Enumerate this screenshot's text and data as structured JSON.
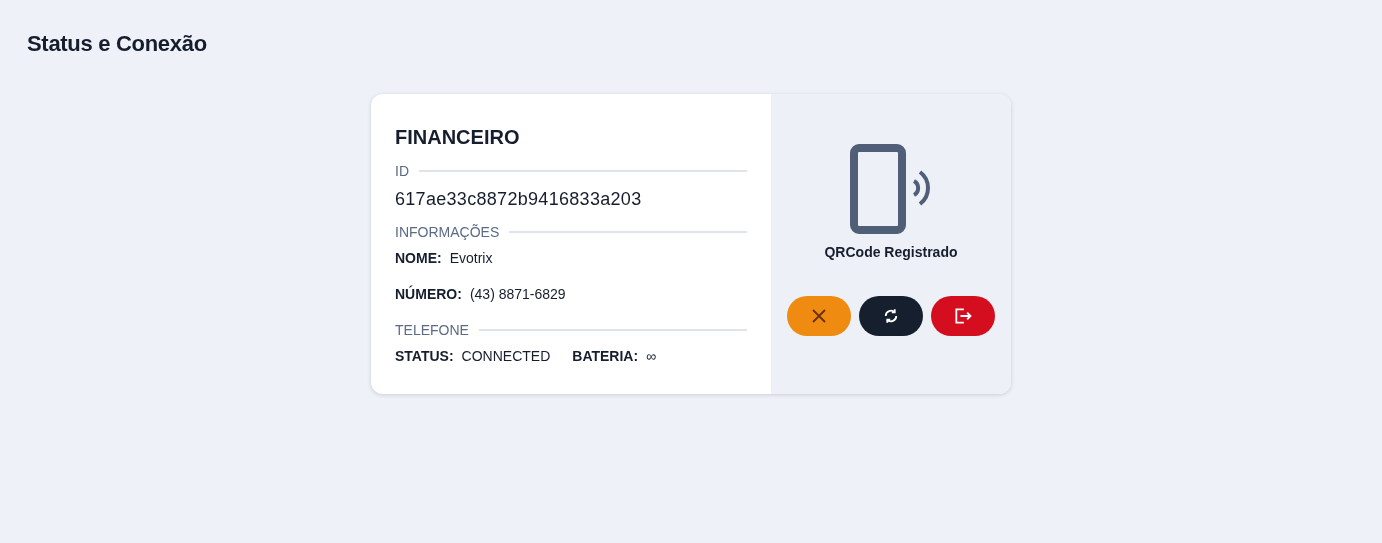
{
  "page": {
    "title": "Status e Conexão"
  },
  "connection": {
    "name": "FINANCEIRO",
    "sections": [
      {
        "label": "ID",
        "kind": "id",
        "value": "617ae33c8872b9416833a203"
      },
      {
        "label": "INFORMAÇÕES",
        "kind": "fields",
        "rows": [
          [
            {
              "label": "NOME:",
              "value": "Evotrix"
            }
          ],
          [
            {
              "label": "NÚMERO:",
              "value": "(43) 8871-6829"
            }
          ]
        ]
      },
      {
        "label": "TELEFONE",
        "kind": "fields",
        "rows": [
          [
            {
              "label": "STATUS:",
              "value": "CONNECTED"
            },
            {
              "label": "BATERIA:",
              "value": "∞"
            }
          ]
        ]
      }
    ],
    "status": "QRCode Registrado",
    "actions": [
      {
        "kind": "cancel"
      },
      {
        "kind": "refresh"
      },
      {
        "kind": "logout"
      }
    ]
  }
}
